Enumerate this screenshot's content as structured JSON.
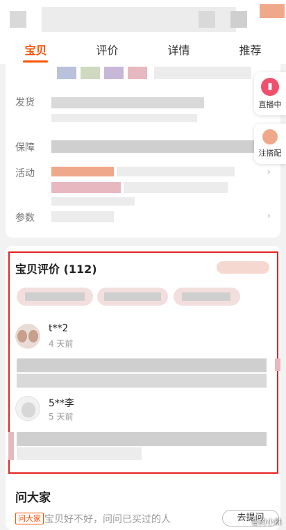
{
  "tabs": [
    {
      "label": "宝贝",
      "active": true
    },
    {
      "label": "评价",
      "active": false
    },
    {
      "label": "详情",
      "active": false
    },
    {
      "label": "推荐",
      "active": false
    }
  ],
  "info_rows": {
    "shipping_label": "发货",
    "guarantee_label": "保障",
    "activity_label": "活动",
    "params_label": "参数"
  },
  "side_buttons": {
    "live_label": "直播中",
    "match_label": "注搭配"
  },
  "reviews": {
    "title": "宝贝评价 (112)",
    "items": [
      {
        "user": "t**2",
        "time": "4 天前"
      },
      {
        "user": "5**李",
        "time": "5 天前"
      }
    ]
  },
  "ask": {
    "title": "问大家",
    "badge": "问大家",
    "prompt": "宝贝好不好，问问已买过的人",
    "button": "去提问"
  },
  "watermark": "鲁的小株",
  "colors": {
    "accent": "#ff5000",
    "highlight": "#e32222"
  }
}
